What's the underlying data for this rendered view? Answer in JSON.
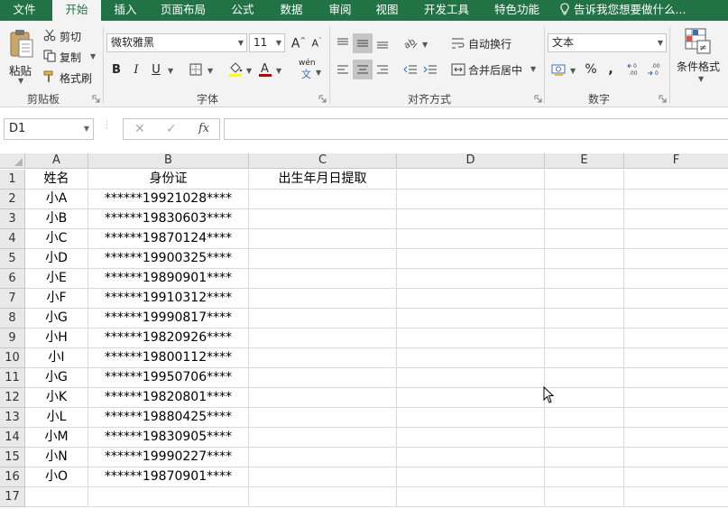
{
  "ribbon_tabs": [
    "文件",
    "开始",
    "插入",
    "页面布局",
    "公式",
    "数据",
    "审阅",
    "视图",
    "开发工具",
    "特色功能"
  ],
  "tell_me": "告诉我您想要做什么...",
  "clipboard": {
    "paste": "粘贴",
    "cut": "剪切",
    "copy": "复制",
    "format_painter": "格式刷",
    "group": "剪贴板"
  },
  "font": {
    "name": "微软雅黑",
    "size": "11",
    "bold": "B",
    "italic": "I",
    "underline": "U",
    "phonetic": "wén",
    "font_color": "#c00000",
    "fill_color": "#ffff00",
    "group": "字体"
  },
  "alignment": {
    "wrap_text": "自动换行",
    "merge_center": "合并后居中",
    "group": "对齐方式"
  },
  "number": {
    "format": "文本",
    "percent": "%",
    "comma": ",",
    "group": "数字"
  },
  "styles": {
    "conditional_formatting": "条件格式"
  },
  "formula_bar": {
    "name_box": "D1",
    "cancel": "✕",
    "enter": "✓",
    "fx": "fx",
    "formula": ""
  },
  "columns": [
    "A",
    "B",
    "C",
    "D",
    "E",
    "F"
  ],
  "rows": [
    "1",
    "2",
    "3",
    "4",
    "5",
    "6",
    "7",
    "8",
    "9",
    "10",
    "11",
    "12",
    "13",
    "14",
    "15",
    "16",
    "17"
  ],
  "cells": [
    [
      "姓名",
      "身份证",
      "出生年月日提取"
    ],
    [
      "小A",
      "******19921028****",
      ""
    ],
    [
      "小B",
      "******19830603****",
      ""
    ],
    [
      "小C",
      "******19870124****",
      ""
    ],
    [
      "小D",
      "******19900325****",
      ""
    ],
    [
      "小E",
      "******19890901****",
      ""
    ],
    [
      "小F",
      "******19910312****",
      ""
    ],
    [
      "小G",
      "******19990817****",
      ""
    ],
    [
      "小H",
      "******19820926****",
      ""
    ],
    [
      "小I",
      "******19800112****",
      ""
    ],
    [
      "小G",
      "******19950706****",
      ""
    ],
    [
      "小K",
      "******19820801****",
      ""
    ],
    [
      "小L",
      "******19880425****",
      ""
    ],
    [
      "小M",
      "******19830905****",
      ""
    ],
    [
      "小N",
      "******19990227****",
      ""
    ],
    [
      "小O",
      "******19870901****",
      ""
    ],
    [
      "",
      "",
      ""
    ]
  ],
  "colors": {
    "accent": "#217346",
    "ribbon_bg": "#f3f3f3",
    "header_bg": "#e9e9e9",
    "gridline": "#dadada"
  }
}
